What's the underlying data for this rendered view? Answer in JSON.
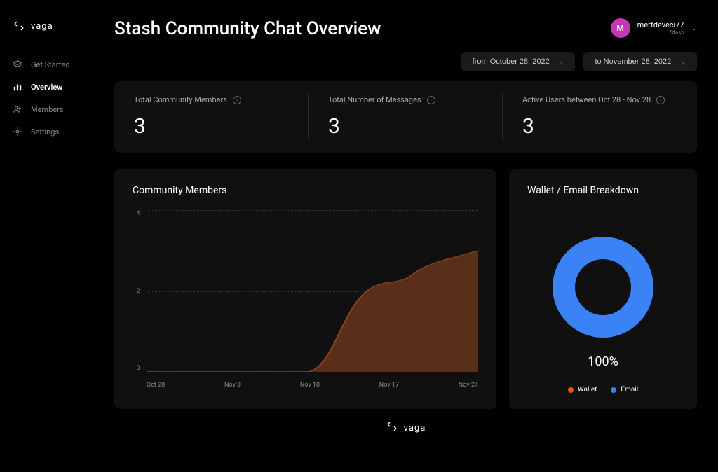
{
  "brand": {
    "name": "vaga"
  },
  "sidebar": {
    "items": [
      {
        "label": "Get Started",
        "active": false
      },
      {
        "label": "Overview",
        "active": true
      },
      {
        "label": "Members",
        "active": false
      },
      {
        "label": "Settings",
        "active": false
      }
    ]
  },
  "header": {
    "title": "Stash Community Chat Overview",
    "user": {
      "initial": "M",
      "name": "mertdeveci77",
      "sub": "Stash"
    }
  },
  "filters": {
    "from": "from October 28, 2022",
    "to": "to November 28, 2022"
  },
  "stats": [
    {
      "label": "Total Community Members",
      "value": "3"
    },
    {
      "label": "Total Number of Messages",
      "value": "3"
    },
    {
      "label": "Active Users between Oct 28 - Nov 28",
      "value": "3"
    }
  ],
  "charts": {
    "members_title": "Community Members",
    "breakdown_title": "Wallet / Email Breakdown",
    "donut_percent": "100%",
    "legend": {
      "wallet": "Wallet",
      "email": "Email"
    },
    "y_ticks": [
      "4",
      "2",
      "0"
    ],
    "x_ticks": [
      "Oct 28",
      "Nov 3",
      "Nov 10",
      "Nov 17",
      "Nov 24"
    ]
  },
  "chart_data": [
    {
      "type": "area",
      "title": "Community Members",
      "x": [
        "Oct 28",
        "Nov 3",
        "Nov 10",
        "Nov 17",
        "Nov 24"
      ],
      "values": [
        0,
        0,
        0,
        2,
        3
      ],
      "ylim": [
        0,
        4
      ],
      "xlabel": "",
      "ylabel": ""
    },
    {
      "type": "pie",
      "title": "Wallet / Email Breakdown",
      "series": [
        {
          "name": "Wallet",
          "value": 0,
          "color": "#ea580c"
        },
        {
          "name": "Email",
          "value": 100,
          "color": "#3b82f6"
        }
      ]
    }
  ]
}
